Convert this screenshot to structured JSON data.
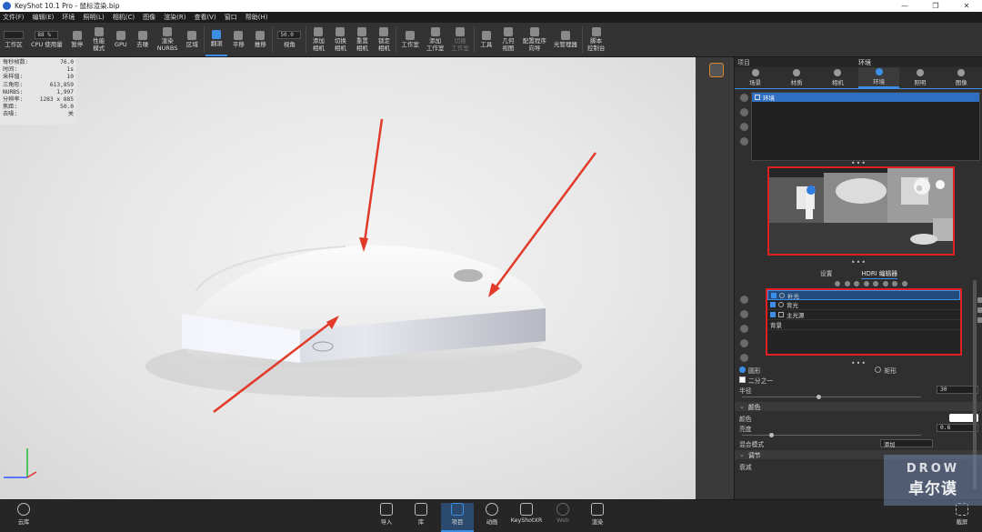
{
  "window": {
    "title": "KeyShot 10.1 Pro  - 鼠标渲染.bip",
    "min": "—",
    "max": "❐",
    "close": "✕"
  },
  "menu": [
    "文件(F)",
    "编辑(E)",
    "环境",
    "照明(L)",
    "相机(C)",
    "图像",
    "渲染(R)",
    "查看(V)",
    "窗口",
    "帮助(H)"
  ],
  "ribbon": {
    "workspace": "工作区",
    "zoom_value": "88 %",
    "cpu": "CPU 使用量",
    "pause": "暂停",
    "perf": "性能\n模式",
    "gpu": "GPU",
    "denoise": "去噪",
    "render_nurbs": "渲染\nNURBS",
    "regions": "区域",
    "tumble": "翻滚",
    "pan": "平移",
    "dolly": "推移",
    "fov_value": "50.0",
    "fov": "视角",
    "add_camera": "添加\n相机",
    "switch_camera": "切换\n相机",
    "reset_camera": "重置\n相机",
    "lock_camera": "锁定\n相机",
    "studio": "工作室",
    "add_studio": "添加\n工作室",
    "switch_studio": "切换\n工作室",
    "tools": "工具",
    "geometry_view": "几何\n视图",
    "configurator": "配置程序\n向导",
    "light_manager": "光管理器",
    "script_console": "脚本\n控制台"
  },
  "stats": [
    {
      "k": "每秒帧数:",
      "v": "76.0"
    },
    {
      "k": "时间:",
      "v": "1s"
    },
    {
      "k": "采样值:",
      "v": "10"
    },
    {
      "k": "三角形:",
      "v": "613,859"
    },
    {
      "k": "NURBS:",
      "v": "1,997"
    },
    {
      "k": "分辨率:",
      "v": "1283 x 885"
    },
    {
      "k": "焦距:",
      "v": "50.0"
    },
    {
      "k": "去噪:",
      "v": "关"
    }
  ],
  "panel": {
    "project_label": "项目",
    "header": "环境",
    "tabs": [
      "场景",
      "材质",
      "相机",
      "环境",
      "照明",
      "图像"
    ],
    "active_tab": 3,
    "env_item": "环境",
    "subtabs": [
      "设置",
      "HDRI 编辑器"
    ],
    "lights": [
      {
        "label": "补光",
        "checked": true
      },
      {
        "label": "背光",
        "checked": true
      },
      {
        "label": "主光源",
        "checked": true
      }
    ],
    "background_row": "背景",
    "shape_circle": "圆形",
    "shape_rect": "矩形",
    "half": "二分之一",
    "radius_label": "半径",
    "radius_value": "30",
    "color_section": "颜色",
    "color_label": "颜色",
    "brightness_label": "亮度",
    "brightness_value": "0.6",
    "blend_label": "混合模式",
    "blend_value": "添加",
    "adjust_section": "调节",
    "falloff_label": "衰减"
  },
  "bottom": {
    "cloud": "云库",
    "import": "导入",
    "library": "库",
    "project": "项目",
    "animation": "动画",
    "keyshotxr": "KeyShotXR",
    "render_dim": "Web",
    "render": "渲染",
    "screenshot": "截屏"
  },
  "watermark": {
    "line1": "DROW",
    "line2": "卓尔谟"
  },
  "colors": {
    "accent": "#3d8ee6",
    "highlight": "#e02020"
  }
}
